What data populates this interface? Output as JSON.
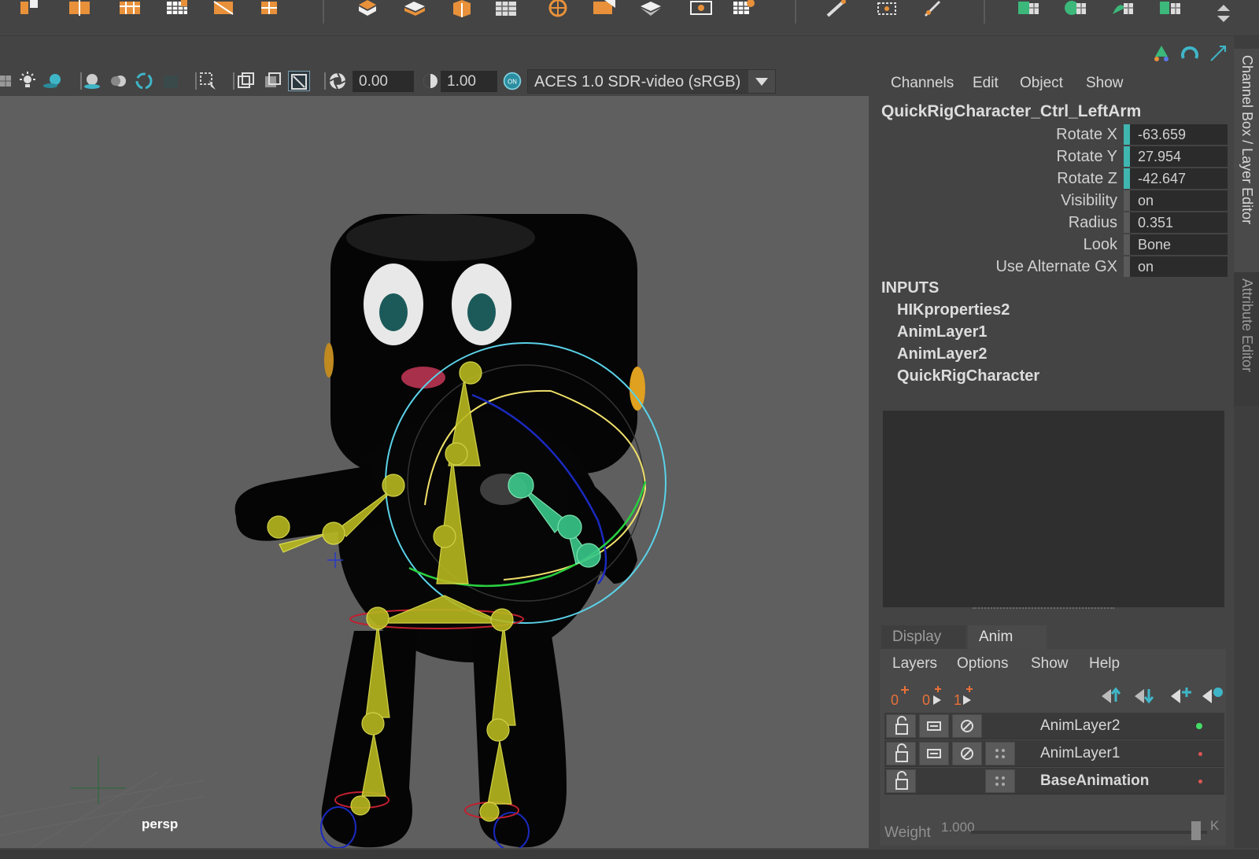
{
  "shelf": {
    "icons": [
      "poly-cube-icon",
      "poly-split-icon",
      "poly-extrude-icon",
      "poly-grid-icon",
      "poly-plane-grid-icon",
      "poly-bevel-icon",
      "poly-cut-icon",
      "poly-box-icon",
      "poly-fold-icon",
      "poly-cube-orange-icon",
      "poly-sphere-grid-icon",
      "poly-wheel-icon",
      "poly-wedge-icon",
      "poly-flat-icon",
      "poly-frame-icon",
      "poly-grid2-icon",
      "sculpt-pencil-icon",
      "multicut-icon",
      "target-weld-icon",
      "uv-green-icon-1",
      "uv-green-icon-2",
      "uv-green-icon-3",
      "uv-green-icon-4"
    ]
  },
  "viewport_toolbar": {
    "exposure_value": "0.00",
    "gamma_value": "1.00",
    "on_badge": "ON",
    "color_space": "ACES 1.0 SDR-video (sRGB)"
  },
  "viewport": {
    "camera_label": "persp"
  },
  "channel_box": {
    "menu": [
      "Channels",
      "Edit",
      "Object",
      "Show"
    ],
    "object_name": "QuickRigCharacter_Ctrl_LeftArm",
    "attributes": [
      {
        "label": "Rotate X",
        "value": "-63.659",
        "keyed": true
      },
      {
        "label": "Rotate Y",
        "value": "27.954",
        "keyed": true
      },
      {
        "label": "Rotate Z",
        "value": "-42.647",
        "keyed": true
      },
      {
        "label": "Visibility",
        "value": "on",
        "keyed": false
      },
      {
        "label": "Radius",
        "value": "0.351",
        "keyed": false
      },
      {
        "label": "Look",
        "value": "Bone",
        "keyed": false
      },
      {
        "label": "Use Alternate GX",
        "value": "on",
        "keyed": false
      }
    ],
    "inputs_title": "INPUTS",
    "inputs": [
      "HIKproperties2",
      "AnimLayer1",
      "AnimLayer2",
      "QuickRigCharacter"
    ]
  },
  "layer_editor": {
    "tabs": [
      {
        "label": "Display",
        "active": false
      },
      {
        "label": "Anim",
        "active": true
      }
    ],
    "menu": [
      "Layers",
      "Options",
      "Show",
      "Help"
    ],
    "layers": [
      {
        "name": "AnimLayer2",
        "bold": false,
        "dot_color": "#44dd66"
      },
      {
        "name": "AnimLayer1",
        "bold": false,
        "dot_color": "#dd5555"
      },
      {
        "name": "BaseAnimation",
        "bold": true,
        "dot_color": "#dd5555"
      }
    ],
    "weight_label": "Weight",
    "weight_value": "1.000",
    "key_label": "K"
  },
  "side_tabs": {
    "channel_box_tab": "Channel Box / Layer Editor",
    "attribute_editor_tab": "Attribute Editor"
  },
  "colors": {
    "keyed_channel": "#3fb6b0",
    "shelf_orange": "#e8913a",
    "shelf_green": "#3bb87a",
    "panel_bg": "#444444"
  }
}
